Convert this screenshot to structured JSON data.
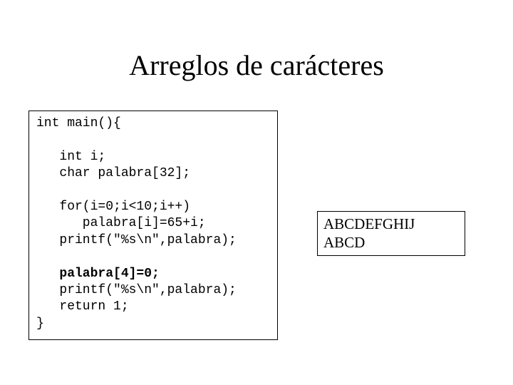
{
  "title": "Arreglos de carácteres",
  "code": {
    "l1": "int main(){",
    "l2": "",
    "l3": "   int i;",
    "l4": "   char palabra[32];",
    "l5": "",
    "l6": "   for(i=0;i<10;i++)",
    "l7": "      palabra[i]=65+i;",
    "l8": "   printf(\"%s\\n\",palabra);",
    "l9": "",
    "l10": "   palabra[4]=0;",
    "l11": "   printf(\"%s\\n\",palabra);",
    "l12": "   return 1;",
    "l13": "}"
  },
  "output": {
    "line1": "ABCDEFGHIJ",
    "line2": "ABCD"
  }
}
